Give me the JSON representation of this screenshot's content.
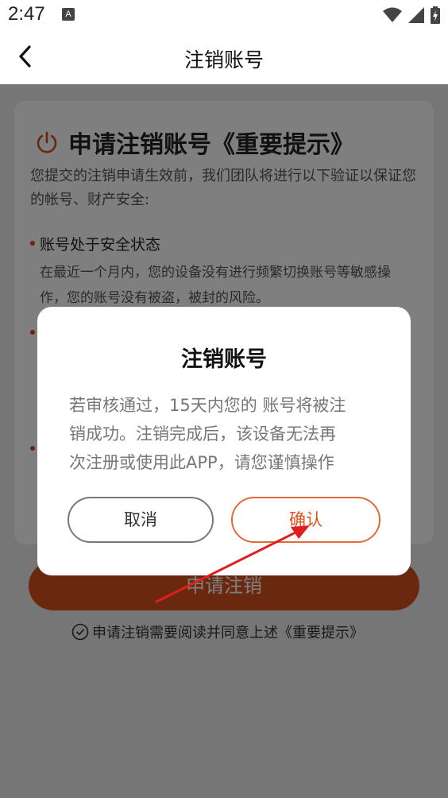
{
  "status_bar": {
    "time": "2:47",
    "notification_icon": "A",
    "icons": [
      "wifi-icon",
      "signal-icon",
      "battery-icon"
    ]
  },
  "nav": {
    "title": "注销账号",
    "back_icon": "chevron-left-icon"
  },
  "card": {
    "title": "申请注销账号《重要提示》",
    "intro": "您提交的注销申请生效前，我们团队将进行以下验证以保证您的帐号、财产安全:",
    "bullets": [
      {
        "title": "账号处于安全状态",
        "text": "在最近一个月内，您的设备没有进行频繁切换账号等敏感操作，您的账号没有被盗，被封的风险。"
      }
    ]
  },
  "apply_button": {
    "label": "申请注销"
  },
  "agreement": {
    "text": "申请注销需要阅读并同意上述《重要提示》"
  },
  "dialog": {
    "title": "注销账号",
    "message_lines": [
      "若审核通过，15天内您的 账号将被注",
      "销成功。注销完成后，该设备无法再",
      "次注册或使用此APP，请您谨慎操作"
    ],
    "cancel_label": "取消",
    "confirm_label": "确认"
  },
  "colors": {
    "accent": "#d4521c",
    "confirm_border": "#e26a3a",
    "annotation_arrow": "#e01e1e"
  }
}
